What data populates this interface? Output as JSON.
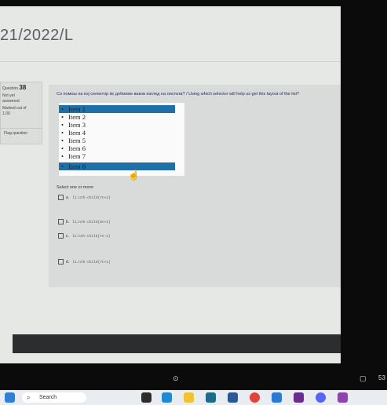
{
  "course": {
    "title": "21/2022/L"
  },
  "question_info": {
    "label": "Question",
    "number": "38",
    "status_lines": [
      "Not yet",
      "answered",
      "Marked out of",
      "1.00"
    ],
    "flag_label": "Flag question"
  },
  "question": {
    "text": "Со помош на кој селектор ќе добиеме ваков изглед на листата? / Using which selector will help us get this layout of the list?",
    "list_items": [
      "Item 1",
      "Item 2",
      "Item 3",
      "Item 4",
      "Item 5",
      "Item 6",
      "Item 7",
      "Item 8"
    ],
    "highlighted_items": [
      1,
      8
    ],
    "select_prompt": "Select one or more:",
    "options": [
      {
        "letter": "a.",
        "code": "li:nth-child(7n+2)"
      },
      {
        "letter": "b.",
        "code": "li:nth-child(8n+1)"
      },
      {
        "letter": "c.",
        "code": "li:nth-child(7n-1)"
      },
      {
        "letter": "d.",
        "code": "li:nth-child(7n+2)"
      }
    ]
  },
  "video_controls": {
    "time_fragment": "53"
  },
  "taskbar": {
    "search_placeholder": "Search"
  },
  "colors": {
    "highlight": "#1f6fa8",
    "page_bg": "#e6e8e6"
  }
}
